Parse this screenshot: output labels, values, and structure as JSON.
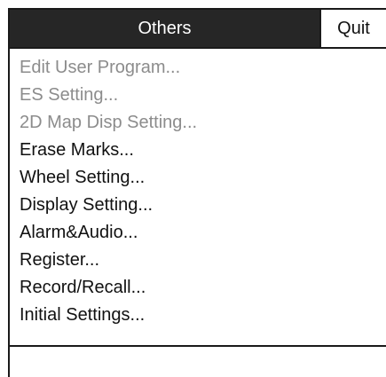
{
  "header": {
    "title": "Others",
    "quit_label": "Quit"
  },
  "menu": {
    "items": [
      {
        "label": "Edit User Program...",
        "enabled": false
      },
      {
        "label": "ES Setting...",
        "enabled": false
      },
      {
        "label": "2D Map Disp Setting...",
        "enabled": false
      },
      {
        "label": "Erase Marks...",
        "enabled": true
      },
      {
        "label": "Wheel Setting...",
        "enabled": true
      },
      {
        "label": "Display Setting...",
        "enabled": true
      },
      {
        "label": "Alarm&Audio...",
        "enabled": true
      },
      {
        "label": "Register...",
        "enabled": true
      },
      {
        "label": "Record/Recall...",
        "enabled": true
      },
      {
        "label": "Initial Settings...",
        "enabled": true
      }
    ]
  },
  "colors": {
    "title_bg": "#262626",
    "title_text": "#ffffff",
    "enabled_text": "#111111",
    "disabled_text": "#8c8c8c"
  }
}
